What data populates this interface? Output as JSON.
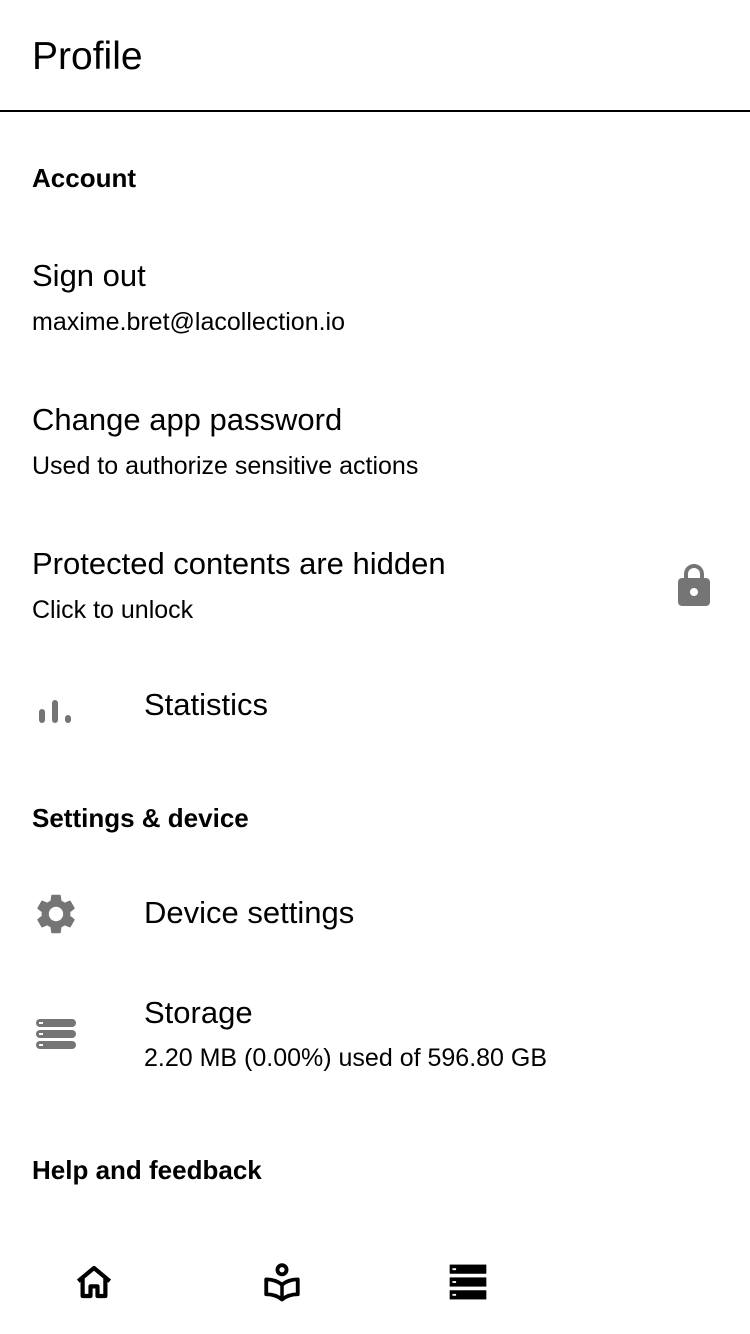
{
  "header": {
    "title": "Profile"
  },
  "sections": {
    "account": "Account",
    "settings_device": "Settings & device",
    "help_feedback": "Help and feedback"
  },
  "items": {
    "sign_out": {
      "title": "Sign out",
      "subtitle": "maxime.bret@lacollection.io"
    },
    "change_password": {
      "title": "Change app password",
      "subtitle": "Used to authorize sensitive actions"
    },
    "protected": {
      "title": "Protected contents are hidden",
      "subtitle": "Click to unlock",
      "icon": "lock-icon"
    },
    "statistics": {
      "title": "Statistics",
      "icon": "bar-chart-icon"
    },
    "device_settings": {
      "title": "Device settings",
      "icon": "gear-icon"
    },
    "storage": {
      "title": "Storage",
      "subtitle": "2.20 MB (0.00%) used of 596.80 GB",
      "icon": "storage-icon"
    }
  },
  "bottom_nav": [
    {
      "icon": "home-icon"
    },
    {
      "icon": "reader-icon"
    },
    {
      "icon": "list-icon"
    }
  ],
  "colors": {
    "icon_gray": "#757575",
    "text": "#000000",
    "background": "#ffffff"
  }
}
